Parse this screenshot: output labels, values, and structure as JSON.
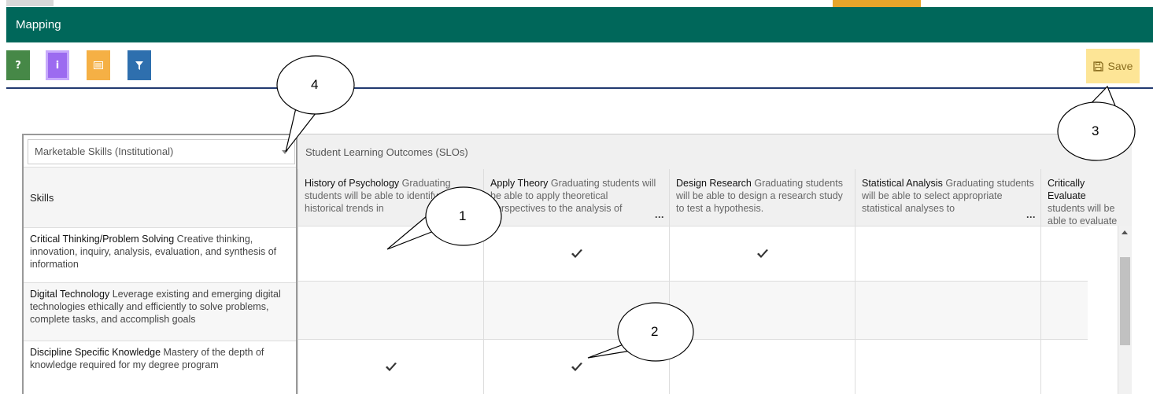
{
  "window": {
    "title": "Mapping"
  },
  "toolbar": {
    "help_glyph": "?",
    "info_glyph": "i",
    "save_label": "Save"
  },
  "icons": [
    "help-icon",
    "info-icon",
    "notes-icon",
    "filter-icon",
    "floppy-disk-icon",
    "checkmark-icon",
    "chevron-down-icon"
  ],
  "colors": {
    "header": "#00675a",
    "help": "#468847",
    "info": "#9c6bf0",
    "notes": "#f5b045",
    "filter": "#2e6fae",
    "save": "#fde596"
  },
  "selector": {
    "value": "Marketable Skills (Institutional)"
  },
  "slo_header": "Student Learning Outcomes (SLOs)",
  "skills_header": "Skills",
  "slos": [
    {
      "title": "History of Psychology",
      "desc": "Graduating students will be able to identify major historical trends in",
      "more": ""
    },
    {
      "title": "Apply Theory",
      "desc": "Graduating students will be able to apply theoretical perspectives to the analysis of",
      "more": "…"
    },
    {
      "title": "Design Research",
      "desc": "Graduating students will be able to design a research study to test a hypothesis.",
      "more": ""
    },
    {
      "title": "Statistical Analysis",
      "desc": "Graduating students will be able to select appropriate statistical analyses to",
      "more": "…"
    },
    {
      "title": "Critically Evaluate",
      "desc": "students will be able to evaluate arguments",
      "more": ""
    }
  ],
  "skills": [
    {
      "title": "Critical Thinking/Problem Solving",
      "desc": "Creative thinking, innovation, inquiry, analysis, evaluation, and synthesis of information",
      "marks": [
        false,
        true,
        true,
        false,
        false
      ]
    },
    {
      "title": "Digital Technology",
      "desc": "Leverage existing and emerging digital technologies ethically and efficiently to solve problems, complete tasks, and accomplish goals",
      "marks": [
        false,
        false,
        false,
        false,
        false
      ]
    },
    {
      "title": "Discipline Specific Knowledge",
      "desc": "Mastery of the depth of knowledge required for my degree program",
      "marks": [
        true,
        true,
        false,
        false,
        false
      ]
    }
  ],
  "callouts": [
    "1",
    "2",
    "3",
    "4"
  ]
}
